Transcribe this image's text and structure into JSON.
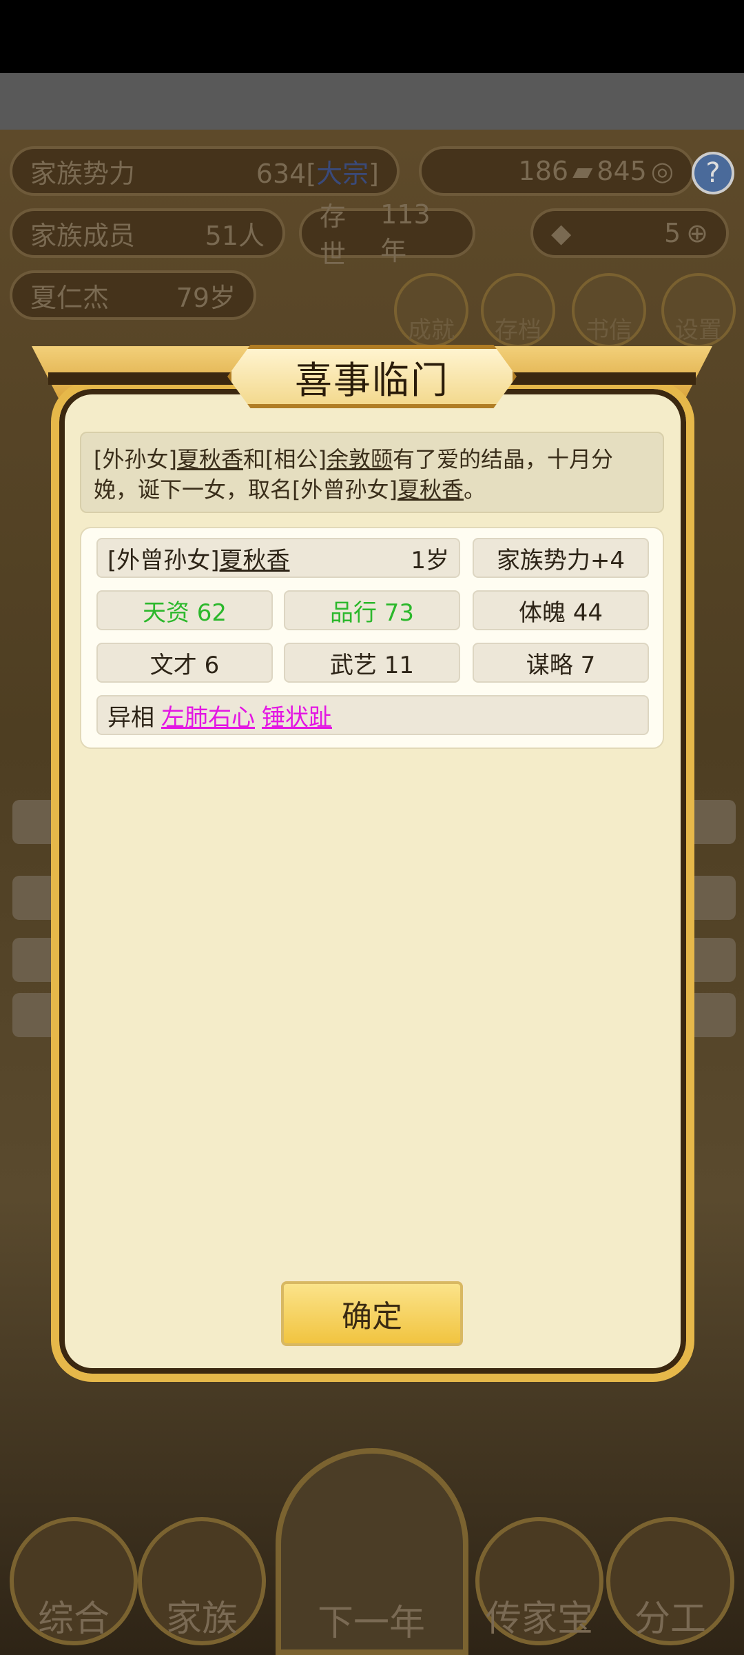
{
  "background": {
    "family_power_label": "家族势力",
    "family_power_value": "634[",
    "family_power_rank": "大宗",
    "family_power_close": "]",
    "currency_amount": "186",
    "coin_amount": "845",
    "members_label": "家族成员",
    "members_value": "51人",
    "existence_label": "存世",
    "existence_value": "113年",
    "gold_value": "5",
    "patriarch_name": "夏仁杰",
    "patriarch_age": "79岁",
    "buttons": [
      "成就",
      "存档",
      "书信",
      "设置"
    ],
    "bottom_nav": [
      "综合",
      "家族",
      "下一年",
      "传家宝",
      "分工"
    ]
  },
  "dialog": {
    "title": "喜事临门",
    "desc_part1": "[外孙女]",
    "desc_name1": "夏秋香",
    "desc_part2": "和[相公]",
    "desc_name2": "余敦颐",
    "desc_part3": "有了爱的结晶，十月分娩，诞下一女，取名[外曾孙女]",
    "desc_name3": "夏秋香",
    "desc_part4": "。",
    "child_relation": "[外曾孙女]",
    "child_name": "夏秋香",
    "child_age": "1岁",
    "family_power_bonus": "家族势力+4",
    "stats": {
      "talent": "天资 62",
      "conduct": "品行 73",
      "physique": "体魄 44",
      "literary": "文才 6",
      "martial": "武艺 11",
      "strategy": "谋略 7"
    },
    "traits_label": "异相",
    "traits": [
      "左肺右心",
      "锤状趾"
    ],
    "confirm_label": "确定"
  }
}
